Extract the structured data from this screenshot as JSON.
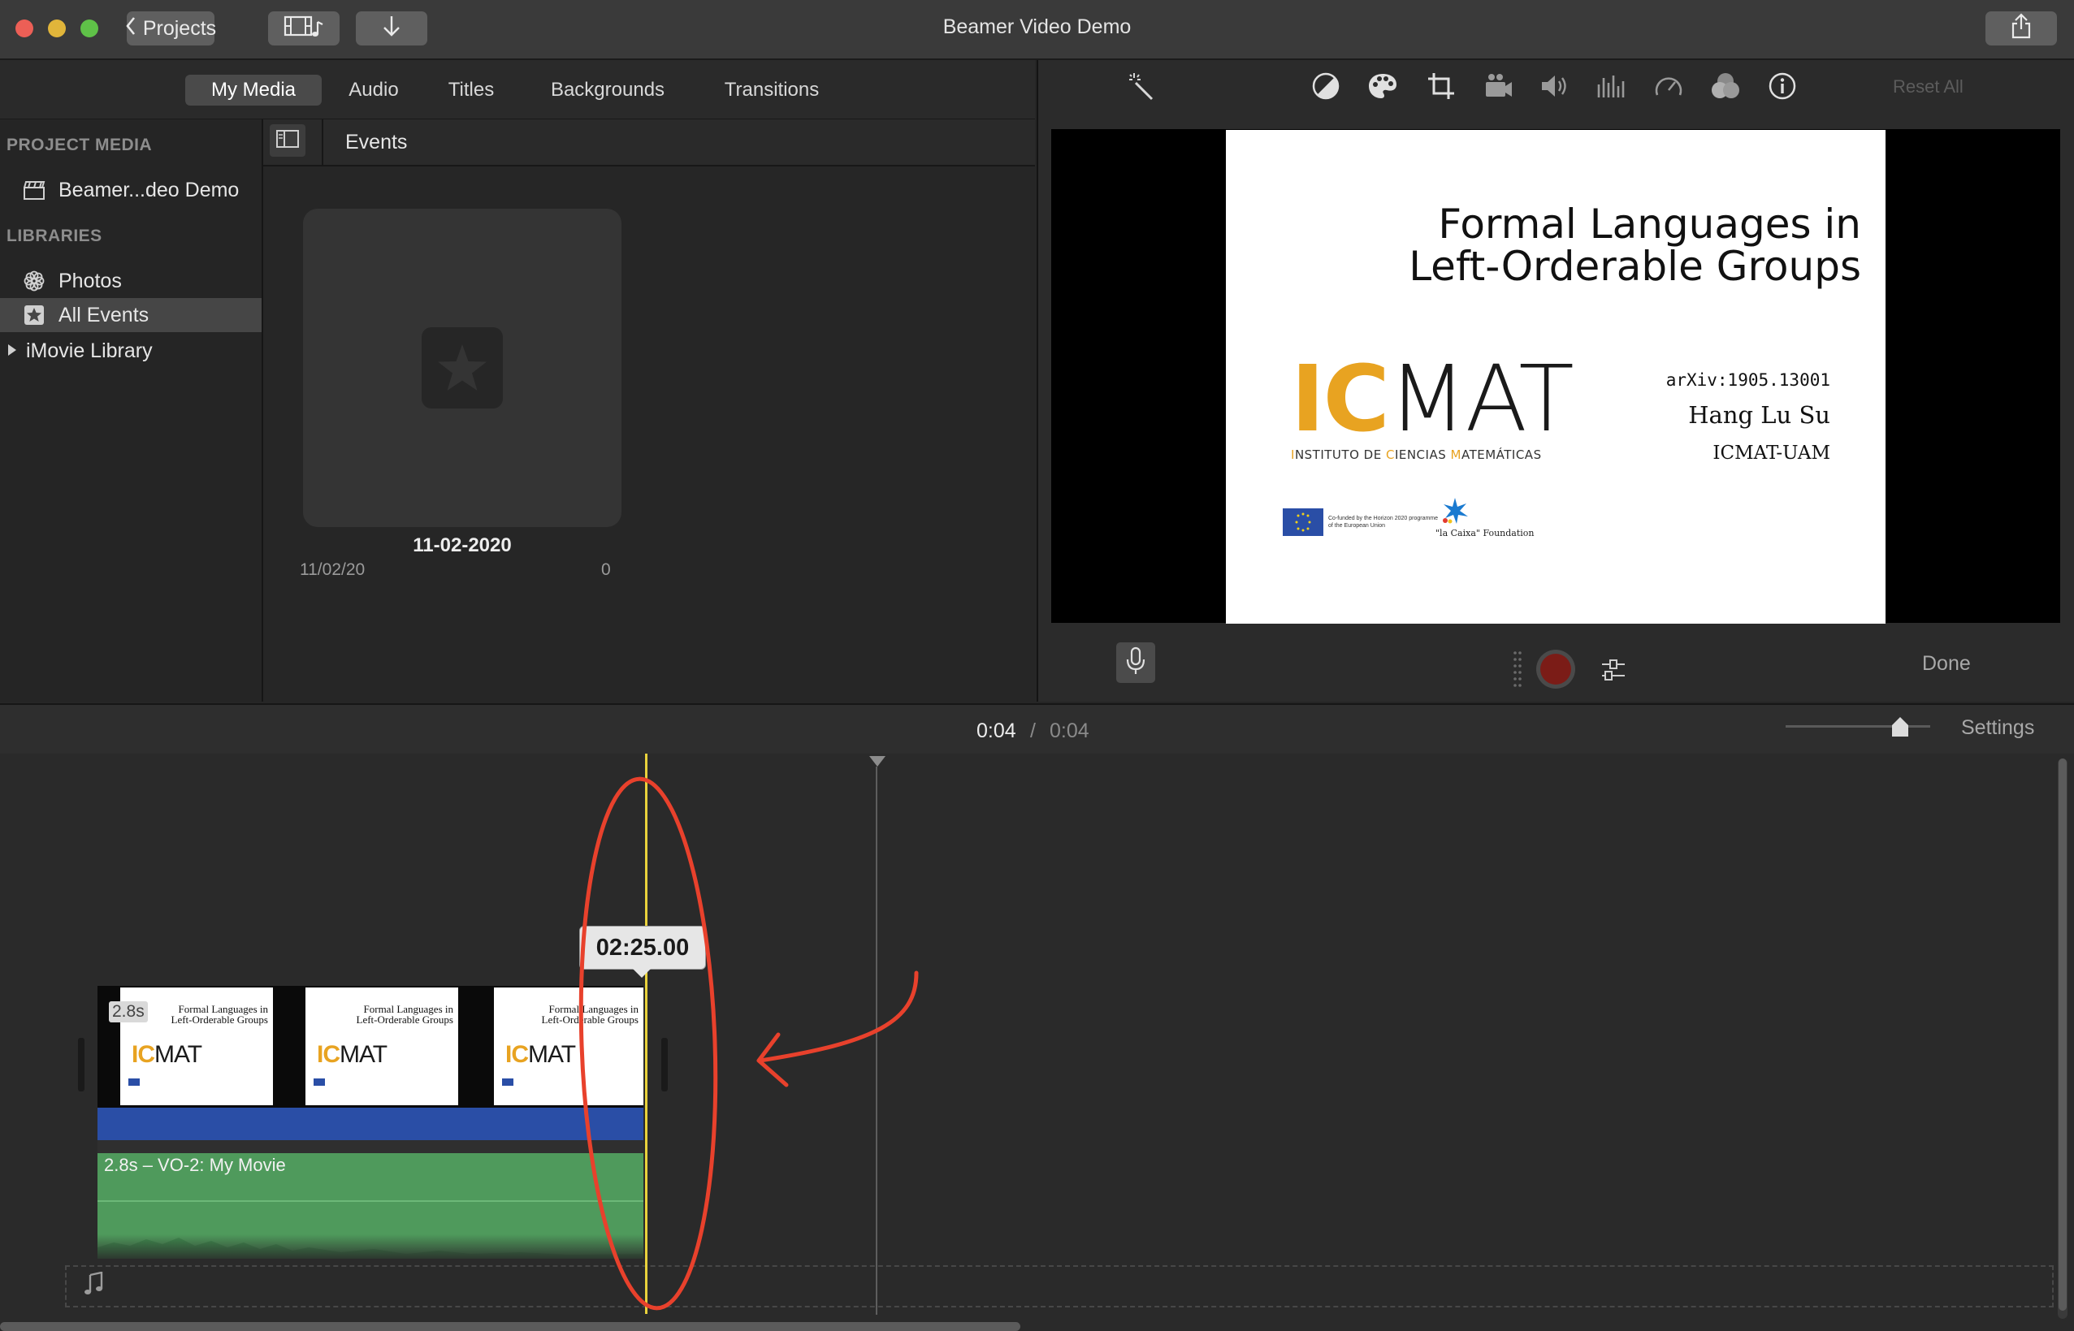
{
  "window": {
    "title": "Beamer Video Demo"
  },
  "toolbar": {
    "projects_label": "Projects"
  },
  "browser": {
    "tabs": [
      {
        "label": "My Media",
        "selected": true
      },
      {
        "label": "Audio"
      },
      {
        "label": "Titles"
      },
      {
        "label": "Backgrounds"
      },
      {
        "label": "Transitions"
      }
    ],
    "sidebar": {
      "project_media_heading": "PROJECT MEDIA",
      "project_item": "Beamer...deo Demo",
      "libraries_heading": "LIBRARIES",
      "photos": "Photos",
      "all_events": "All Events",
      "imovie_library": "iMovie Library"
    },
    "events_label": "Events",
    "event": {
      "name": "11-02-2020",
      "date": "11/02/20",
      "count": "0"
    }
  },
  "viewer": {
    "reset_all": "Reset All",
    "done": "Done",
    "slide": {
      "title_line1": "Formal Languages in",
      "title_line2": "Left-Orderable Groups",
      "logo_ic": "IC",
      "logo_mat": "MAT",
      "logo_sub_parts": [
        "I",
        "NSTITUTO DE ",
        "C",
        "IENCIAS ",
        "M",
        "ATEMÁTICAS"
      ],
      "arxiv": "arXiv:1905.13001",
      "author": "Hang Lu Su",
      "affiliation": "ICMAT-UAM",
      "eu_text_1": "Co-funded by the Horizon 2020 programme",
      "eu_text_2": "of the European Union",
      "foundation": "\"la Caixa\" Foundation"
    }
  },
  "timeline": {
    "time_current": "0:04",
    "separator": "/",
    "time_total": "0:04",
    "settings": "Settings",
    "zoom_level": 0.79,
    "tooltip": "02:25.00",
    "clip_badge": "2.8s",
    "audio_label": "2.8s – VO-2: My Movie"
  },
  "colors": {
    "accent_orange": "#e8a321",
    "annotation_red": "#e8412c",
    "clip_blue": "#2a4ea6",
    "audio_green": "#4f9a5c",
    "playhead_yellow": "#e9d23c"
  }
}
